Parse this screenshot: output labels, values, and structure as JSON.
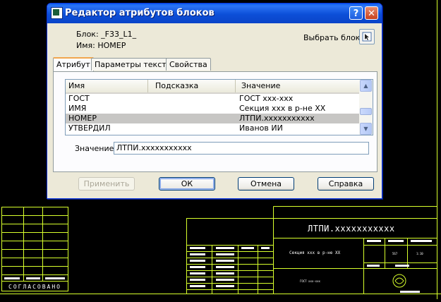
{
  "dialog": {
    "title": "Редактор атрибутов блоков",
    "block_label": "Блок: _F33_L1_",
    "name_label": "Имя: НОМЕР",
    "pick_label": "Выбрать блок",
    "tabs": [
      {
        "label": "Атрибут",
        "active": true
      },
      {
        "label": "Параметры текста",
        "active": false
      },
      {
        "label": "Свойства",
        "active": false
      }
    ],
    "grid": {
      "columns": [
        "Имя",
        "Подсказка",
        "Значение"
      ],
      "rows": [
        {
          "name": "ГОСТ",
          "prompt": "",
          "value": "ГОСТ ххх-ххх",
          "selected": false
        },
        {
          "name": "ИМЯ",
          "prompt": "",
          "value": "Секция  ххх в  р-не ХХ",
          "selected": false
        },
        {
          "name": "НОМЕР",
          "prompt": "",
          "value": "ЛТПИ.ххххххххххх",
          "selected": true
        },
        {
          "name": "УТВЕРДИЛ",
          "prompt": "",
          "value": "Иванов ИИ",
          "selected": false
        }
      ]
    },
    "value_label": "Значение:",
    "value": "ЛТПИ.ххххххххххх",
    "buttons": {
      "apply": "Применить",
      "ok": "ОК",
      "cancel": "Отмена",
      "help": "Справка"
    }
  },
  "drawing": {
    "designation": "ЛТПИ.ххххххххххх",
    "section_name": "Секция  ххх в  р-не ХХ",
    "standard": "ГОСТ ххх-ххх",
    "agreed": "СОГЛАСОВАНО",
    "sheet_value": "567",
    "scale_value": "1:10",
    "line_color": "#d8ff2c",
    "background": "#000000"
  }
}
